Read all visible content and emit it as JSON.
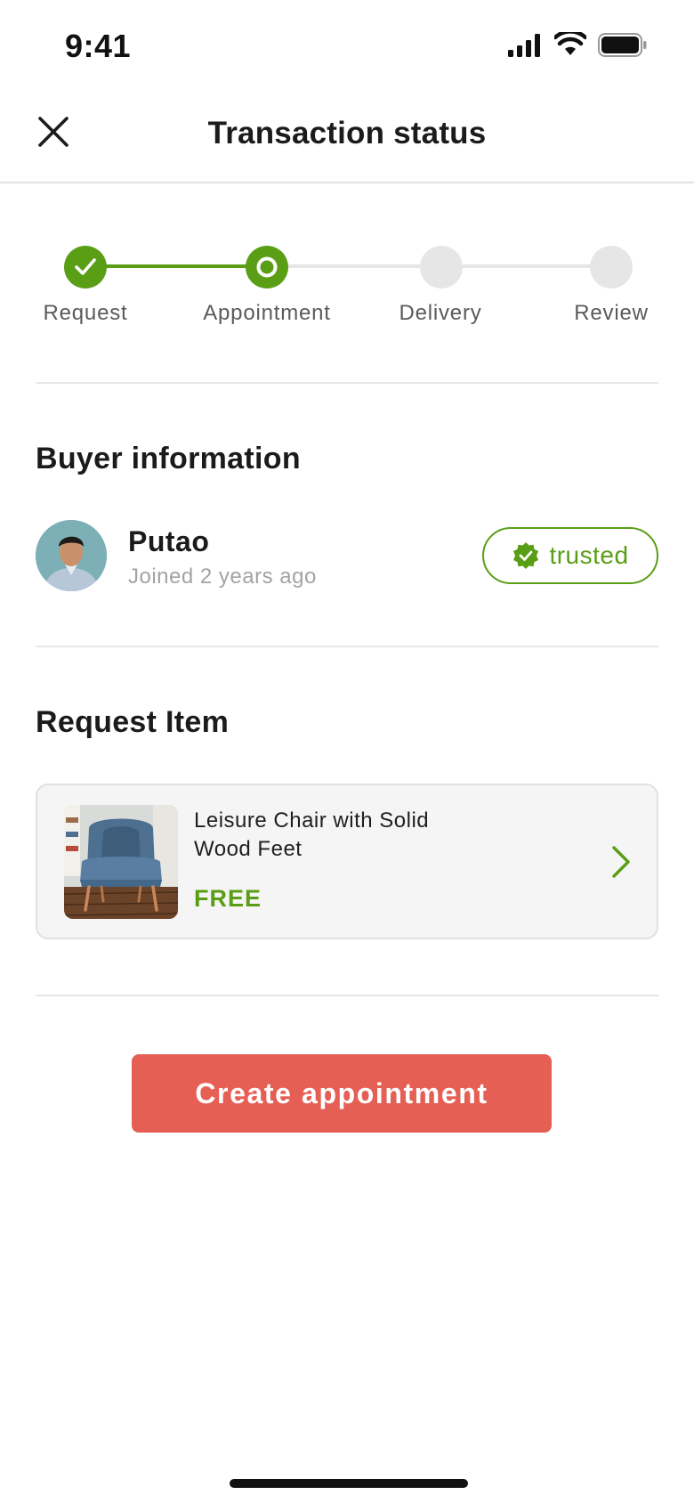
{
  "status_bar": {
    "time": "9:41"
  },
  "nav": {
    "title": "Transaction status"
  },
  "stepper": {
    "steps": [
      {
        "label": "Request",
        "state": "completed"
      },
      {
        "label": "Appointment",
        "state": "current"
      },
      {
        "label": "Delivery",
        "state": "pending"
      },
      {
        "label": "Review",
        "state": "pending"
      }
    ]
  },
  "buyer": {
    "section_title": "Buyer information",
    "name": "Putao",
    "joined": "Joined 2 years ago",
    "badge": "trusted"
  },
  "request_item": {
    "section_title": "Request Item",
    "title": "Leisure Chair with Solid Wood Feet",
    "price": "FREE"
  },
  "cta": {
    "label": "Create appointment"
  },
  "colors": {
    "accent_green": "#5a9e16",
    "cta_red": "#e65f55",
    "pending_gray": "#e6e6e6"
  },
  "icons": {
    "close": "close-icon",
    "step_completed": "check-icon",
    "step_current": "ring-icon",
    "badge": "verified-badge-icon",
    "chevron": "chevron-right-icon"
  }
}
